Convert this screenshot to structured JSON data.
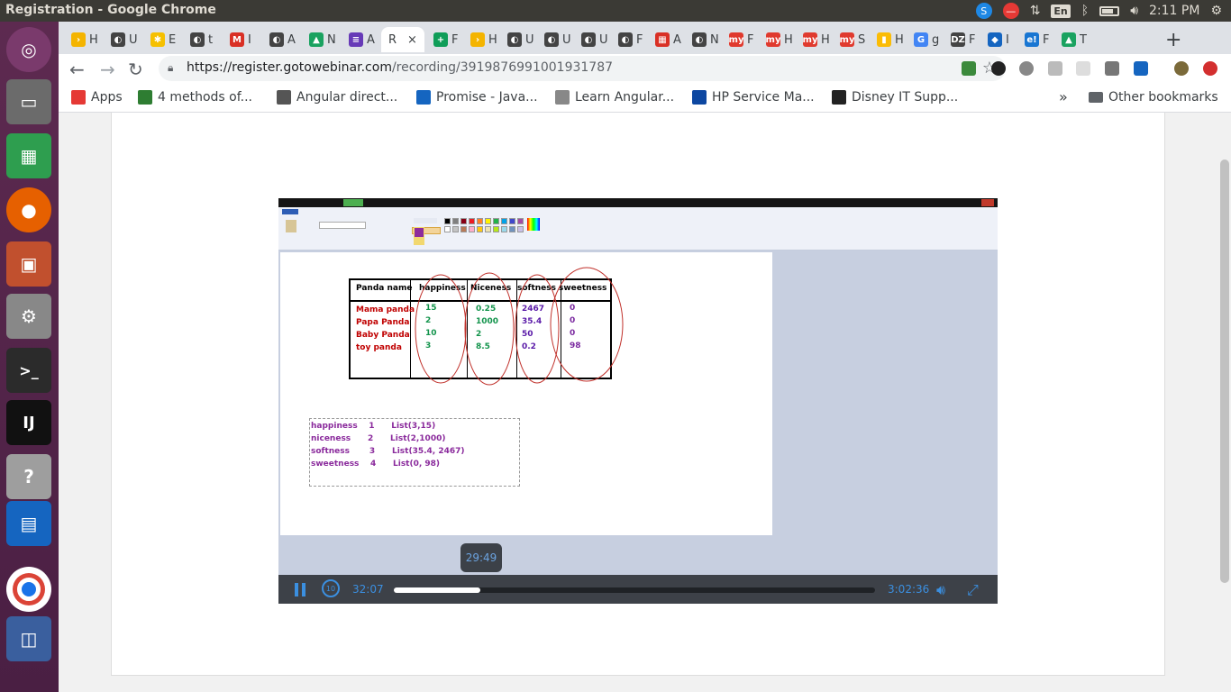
{
  "window": {
    "title": "Registration - Google Chrome"
  },
  "system_tray": {
    "lang": "En",
    "time": "2:11 PM"
  },
  "tabs": [
    {
      "label": "H",
      "fav_color": "#f4b400",
      "fav_glyph": "›"
    },
    {
      "label": "U",
      "fav_color": "#444",
      "fav_glyph": "◐"
    },
    {
      "label": "E",
      "fav_color": "#f6c000",
      "fav_glyph": "✱"
    },
    {
      "label": "t",
      "fav_color": "#444",
      "fav_glyph": "◐"
    },
    {
      "label": "I",
      "fav_color": "#d93025",
      "fav_glyph": "M"
    },
    {
      "label": "A",
      "fav_color": "#444",
      "fav_glyph": "◐"
    },
    {
      "label": "N",
      "fav_color": "#1aa260",
      "fav_glyph": "▲"
    },
    {
      "label": "A",
      "fav_color": "#673ab7",
      "fav_glyph": "≡"
    },
    {
      "label": "R",
      "fav_color": "#fff",
      "fav_glyph": ""
    },
    {
      "label": "F",
      "fav_color": "#0f9d58",
      "fav_glyph": "+"
    },
    {
      "label": "H",
      "fav_color": "#f4b400",
      "fav_glyph": "›"
    },
    {
      "label": "U",
      "fav_color": "#444",
      "fav_glyph": "◐"
    },
    {
      "label": "U",
      "fav_color": "#444",
      "fav_glyph": "◐"
    },
    {
      "label": "U",
      "fav_color": "#444",
      "fav_glyph": "◐"
    },
    {
      "label": "F",
      "fav_color": "#444",
      "fav_glyph": "◐"
    },
    {
      "label": "A",
      "fav_color": "#d93025",
      "fav_glyph": "▦"
    },
    {
      "label": "N",
      "fav_color": "#444",
      "fav_glyph": "◐"
    },
    {
      "label": "F",
      "fav_color": "#e03a2e",
      "fav_glyph": "my"
    },
    {
      "label": "H",
      "fav_color": "#e03a2e",
      "fav_glyph": "my"
    },
    {
      "label": "H",
      "fav_color": "#e03a2e",
      "fav_glyph": "my"
    },
    {
      "label": "S",
      "fav_color": "#e03a2e",
      "fav_glyph": "my"
    },
    {
      "label": "H",
      "fav_color": "#fbbc05",
      "fav_glyph": "▮"
    },
    {
      "label": "g",
      "fav_color": "#4285f4",
      "fav_glyph": "G"
    },
    {
      "label": "F",
      "fav_color": "#444",
      "fav_glyph": "DZ"
    },
    {
      "label": "I",
      "fav_color": "#1565c0",
      "fav_glyph": "◆"
    },
    {
      "label": "F",
      "fav_color": "#1976d2",
      "fav_glyph": "e!"
    },
    {
      "label": "T",
      "fav_color": "#1aa260",
      "fav_glyph": "▲"
    }
  ],
  "active_tab": {
    "label": "R",
    "close": "×"
  },
  "newtab_label": "+",
  "toolbar": {
    "back": "←",
    "forward": "→",
    "reload": "↻",
    "url_host": "https://register.gotowebinar.com",
    "url_path": "/recording/3919876991001931787",
    "star": "☆"
  },
  "bookmarks": [
    {
      "label": "Apps",
      "icon": "apps-icon",
      "color": "#e53935"
    },
    {
      "label": "4 methods of...",
      "icon": "avatar-icon",
      "color": "#2e7d32"
    },
    {
      "label": "Angular direct...",
      "icon": "globe-icon",
      "color": "#555"
    },
    {
      "label": "Promise - Java...",
      "icon": "mdn-icon",
      "color": "#1565c0"
    },
    {
      "label": "Learn Angular...",
      "icon": "code-icon",
      "color": "#888"
    },
    {
      "label": "HP Service Ma...",
      "icon": "hp-icon",
      "color": "#0d47a1"
    },
    {
      "label": "Disney IT Supp...",
      "icon": "disney-icon",
      "color": "#222"
    }
  ],
  "bookmarks_more": "»",
  "other_bookmarks": "Other bookmarks",
  "paint": {
    "headers": [
      "Panda name",
      "happiness",
      "Niceness",
      "softness",
      "sweetness"
    ],
    "names": [
      "Mama panda",
      "Papa Panda",
      "Baby Panda",
      "toy panda"
    ],
    "happiness": [
      "15",
      "2",
      "10",
      "3"
    ],
    "niceness": [
      "0.25",
      "1000",
      "2",
      "8.5"
    ],
    "softness": [
      "2467",
      "35.4",
      "50",
      "0.2"
    ],
    "sweetness": [
      "0",
      "0",
      "0",
      "98"
    ],
    "list_lines": [
      "happiness    1      List(3,15)",
      "niceness      2      List(2,1000)",
      "softness       3      List(35.4, 2467)",
      "sweetness    4      List(0, 98)"
    ]
  },
  "player": {
    "hover_time": "29:49",
    "current_time": "32:07",
    "duration": "3:02:36",
    "progress": 0.18,
    "rewind_label": "10"
  }
}
